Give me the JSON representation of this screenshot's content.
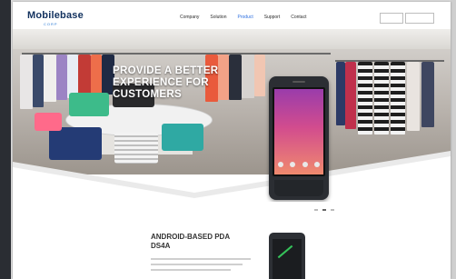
{
  "brand": {
    "logo_text": "Mobilebase",
    "logo_sub": "CORP"
  },
  "nav": {
    "items": [
      "Company",
      "Solution",
      "Product",
      "Support",
      "Contact"
    ],
    "active_index": 2
  },
  "hero": {
    "headline_line1": "PROVIDE A BETTER",
    "headline_line2": "EXPERIENCE  FOR",
    "headline_line3": "CUSTOMERS",
    "slide_count": 3,
    "active_slide": 1
  },
  "product": {
    "title_line1": "ANDROID-BASED PDA",
    "title_line2": "DS4A"
  },
  "colors": {
    "brand": "#12315e",
    "accent": "#2d6fe0",
    "nav_text": "#2c2c2c"
  }
}
